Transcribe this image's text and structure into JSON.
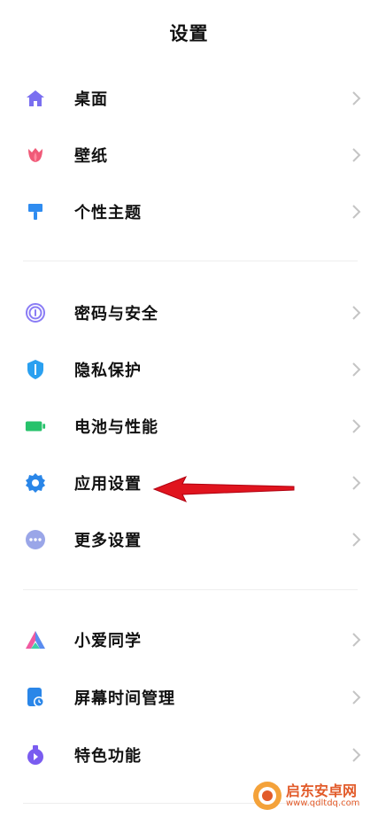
{
  "header": {
    "title": "设置"
  },
  "groups": [
    [
      {
        "label": "桌面",
        "icon": "home-icon",
        "color": "#7a6ff0"
      },
      {
        "label": "壁纸",
        "icon": "tulip-icon",
        "color": "#f05a78"
      },
      {
        "label": "个性主题",
        "icon": "brush-icon",
        "color": "#2f8cf0"
      }
    ],
    [
      {
        "label": "密码与安全",
        "icon": "fingerprint-icon",
        "color": "#8a7cf5"
      },
      {
        "label": "隐私保护",
        "icon": "shield-icon",
        "color": "#2aa0f0"
      },
      {
        "label": "电池与性能",
        "icon": "battery-icon",
        "color": "#27c26b"
      },
      {
        "label": "应用设置",
        "icon": "gear-icon",
        "color": "#2a86e8"
      },
      {
        "label": "更多设置",
        "icon": "more-icon",
        "color": "#9aa6e8"
      }
    ],
    [
      {
        "label": "小爱同学",
        "icon": "assistant-icon",
        "color": "#5a8cf0"
      },
      {
        "label": "屏幕时间管理",
        "icon": "screen-time-icon",
        "color": "#2a86e8"
      },
      {
        "label": "特色功能",
        "icon": "features-icon",
        "color": "#7a5cf0"
      }
    ]
  ],
  "annotation": {
    "icon": "red-arrow-icon",
    "color": "#e0141e"
  },
  "watermark": {
    "name": "启东安卓网",
    "url": "www.qdltdq.com"
  }
}
